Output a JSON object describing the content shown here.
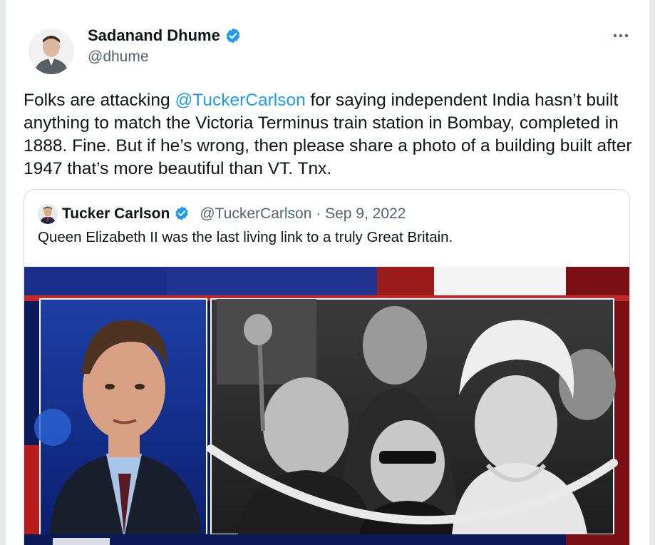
{
  "tweet": {
    "author": {
      "name": "Sadanand Dhume",
      "handle": "@dhume",
      "verified": true
    },
    "text_before": "Folks are attacking ",
    "mention": "@TuckerCarlson",
    "text_after": " for saying independent India hasn’t built anything to match the Victoria Terminus train station in Bombay, completed in 1888. Fine. But if he’s wrong, then please share a photo of a building built after 1947 that’s more beautiful than VT. Tnx.",
    "more_icon": "more-icon"
  },
  "quoted": {
    "author": {
      "name": "Tucker Carlson",
      "handle": "@TuckerCarlson",
      "verified": true
    },
    "separator": "·",
    "date": "Sep 9, 2022",
    "text": "Queen Elizabeth II was the last living link to a truly Great Britain."
  },
  "colors": {
    "link": "#1d9bf0",
    "verified": "#1d9bf0",
    "text": "#0f1419",
    "muted": "#536471",
    "border": "#cfd9de"
  }
}
